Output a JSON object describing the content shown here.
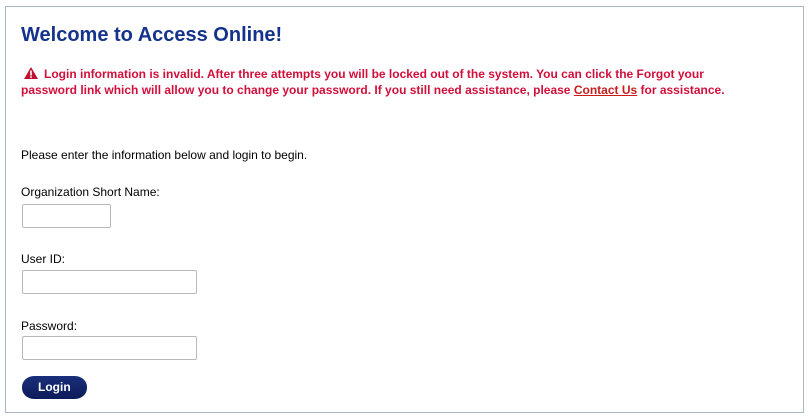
{
  "header": {
    "title": "Welcome to Access Online!"
  },
  "error": {
    "icon": "warning-triangle-icon",
    "text_before_link": "Login information is invalid. After three attempts you will be locked out of the system. You can click the Forgot your password link which will allow you to change your password. If you still need assistance, please ",
    "link_text": "Contact Us",
    "text_after_link": " for assistance.",
    "color": "#d10f3b"
  },
  "intro": "Please enter the information below and login to begin.",
  "form": {
    "org_label": "Organization Short Name:",
    "org_value": "",
    "userid_label": "User ID:",
    "userid_value": "",
    "password_label": "Password:",
    "password_value": "",
    "login_label": "Login"
  },
  "colors": {
    "title": "#15338b",
    "button": "#0c1b5a"
  }
}
